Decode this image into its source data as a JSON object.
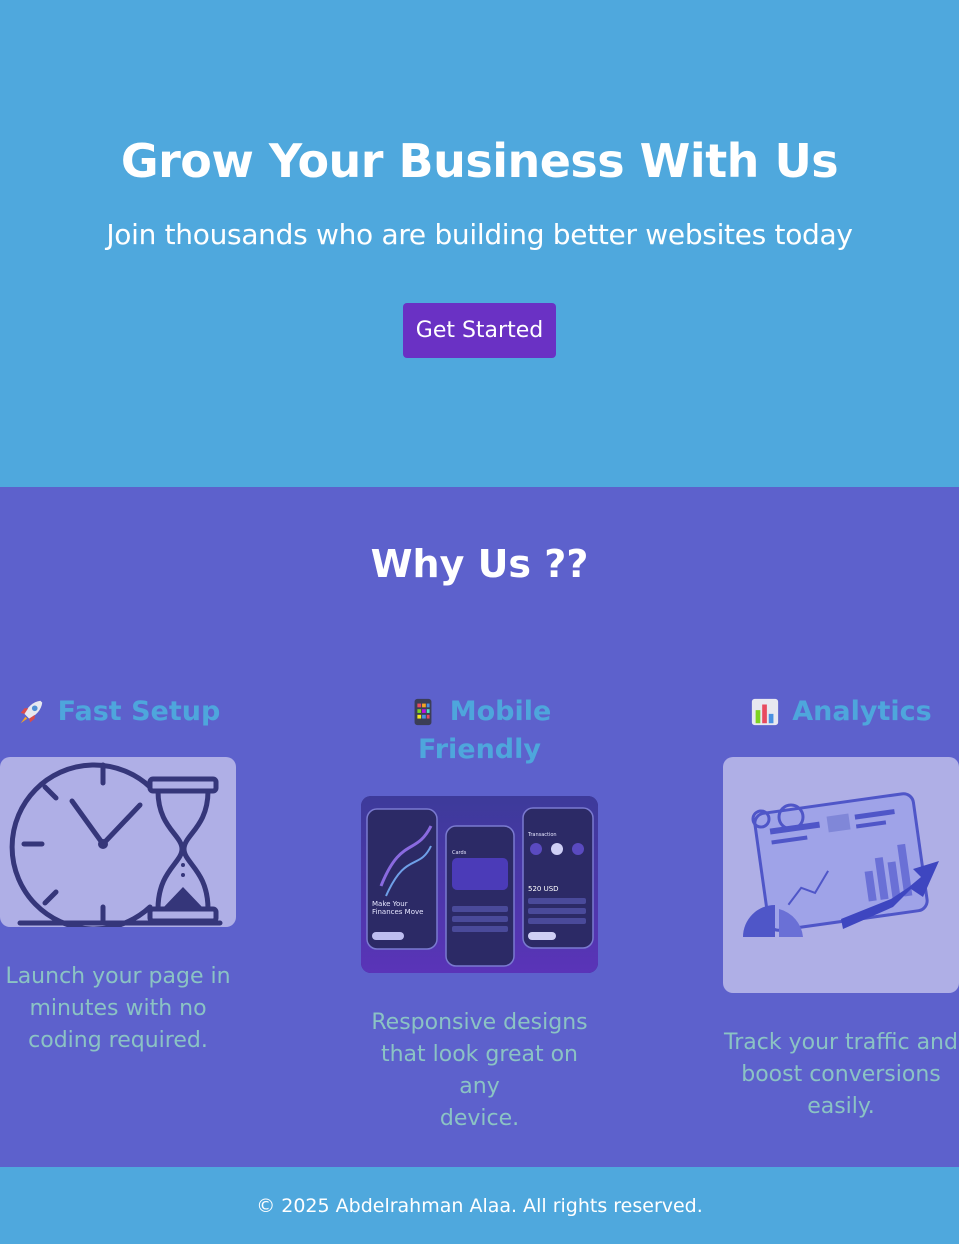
{
  "hero": {
    "title": "Grow Your Business With Us",
    "subtitle": "Join thousands who are building better websites today",
    "cta_label": "Get Started"
  },
  "features": {
    "heading": "Why Us ??",
    "cards": [
      {
        "icon": "rocket-icon",
        "title": "Fast Setup",
        "image": "clock-hourglass-illustration",
        "text_lines": [
          "Launch your page in",
          "minutes with no",
          "coding required."
        ]
      },
      {
        "icon": "mobile-apps-icon",
        "title_lines": [
          "Mobile",
          "Friendly"
        ],
        "image": "mobile-phones-illustration",
        "text_lines": [
          "Responsive designs",
          "that look great on any",
          "device."
        ]
      },
      {
        "icon": "bar-chart-icon",
        "title": "Analytics",
        "image": "analytics-dashboard-illustration",
        "text_lines": [
          "Track your traffic and",
          "boost conversions",
          "easily."
        ]
      }
    ],
    "phone_texts": [
      "Make Your",
      "Finances Move",
      "Transaction",
      "520 USD",
      "Cards"
    ]
  },
  "footer": {
    "text": "© 2025 Abdelrahman Alaa. All rights reserved."
  },
  "colors": {
    "hero_bg": "#4fa8dd",
    "features_bg": "#5d61cc",
    "cta_bg": "#6a31c4",
    "card_title": "#4ea6dc",
    "card_text": "#8bc3c4"
  }
}
